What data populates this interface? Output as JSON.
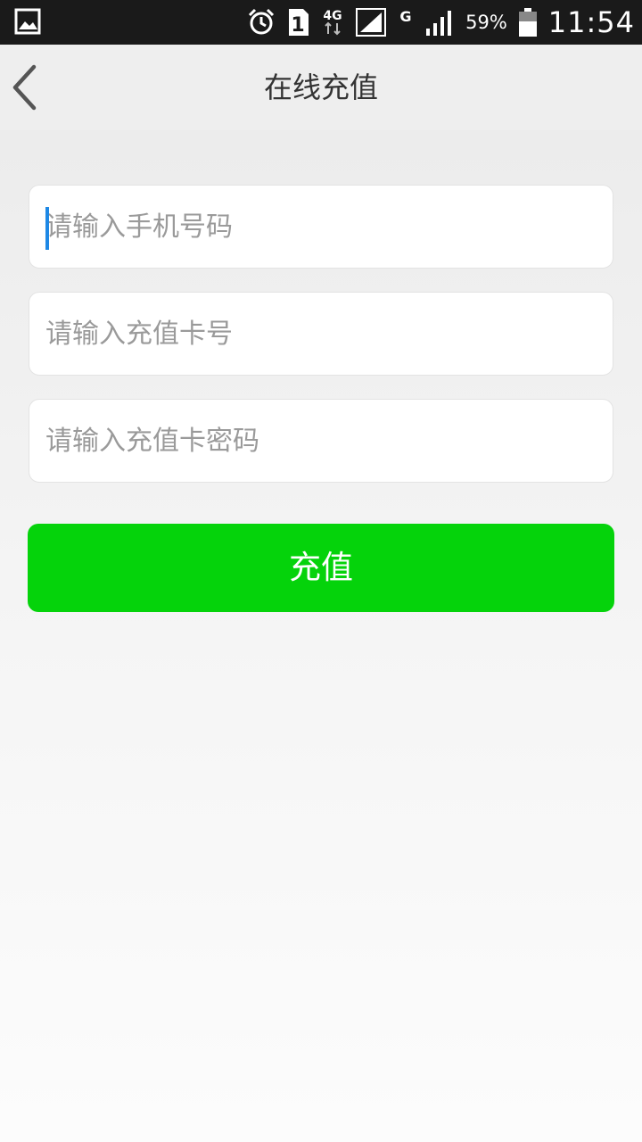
{
  "status_bar": {
    "battery": "59%",
    "time": "11:54",
    "network_4g": "4G",
    "network_g": "G",
    "sim_slot": "1",
    "icons": [
      "gallery-icon",
      "alarm-icon",
      "sim-1-icon",
      "4g-icon",
      "signal-icon",
      "g-icon",
      "signal-icon",
      "battery-icon"
    ]
  },
  "header": {
    "title": "在线充值",
    "back_icon": "chevron-left-icon"
  },
  "form": {
    "phone_placeholder": "请输入手机号码",
    "card_number_placeholder": "请输入充值卡号",
    "card_password_placeholder": "请输入充值卡密码",
    "submit_label": "充值"
  },
  "colors": {
    "accent": "#05d30b",
    "cursor": "#1e88e5",
    "header_bg": "#eeeeee",
    "status_bar_bg": "#1a1a1a"
  }
}
